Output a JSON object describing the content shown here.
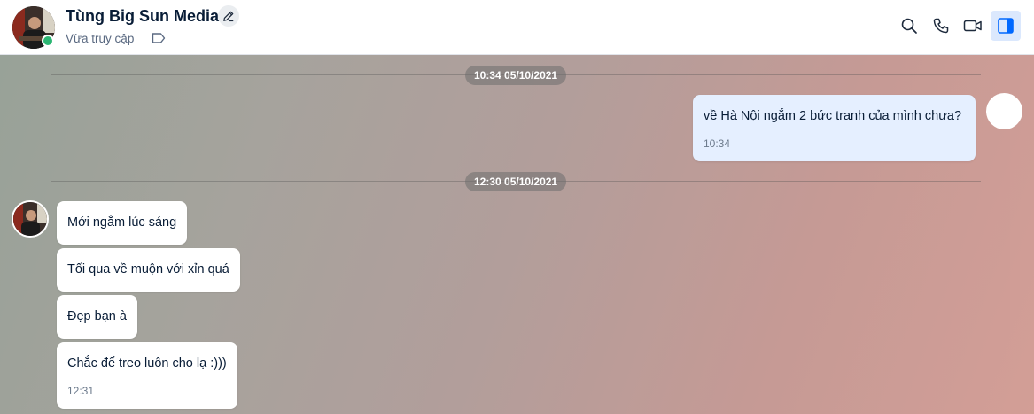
{
  "conversation": {
    "contact_name": "Tùng Big Sun Media",
    "status": "Vừa truy cập"
  },
  "header_actions": [
    {
      "icon": "search-icon"
    },
    {
      "icon": "phone-icon"
    },
    {
      "icon": "video-call-icon"
    },
    {
      "icon": "sidebar-toggle-icon",
      "active": true
    }
  ],
  "colors": {
    "accent": "#0068ff",
    "online": "#2bb673",
    "outgoing_bubble": "#e5efff",
    "incoming_bubble": "#ffffff"
  },
  "messages": {
    "divider_1": "10:34 05/10/2021",
    "outgoing_1": {
      "text": "về Hà Nội ngắm 2 bức tranh của mình chưa?",
      "time": "10:34"
    },
    "divider_2": "12:30 05/10/2021",
    "incoming": [
      {
        "text": "Mới ngắm lúc sáng"
      },
      {
        "text": "Tối qua về muộn với xỉn quá"
      },
      {
        "text": "Đẹp bạn à"
      },
      {
        "text": "Chắc để treo luôn cho lạ :)))",
        "time": "12:31"
      }
    ]
  }
}
